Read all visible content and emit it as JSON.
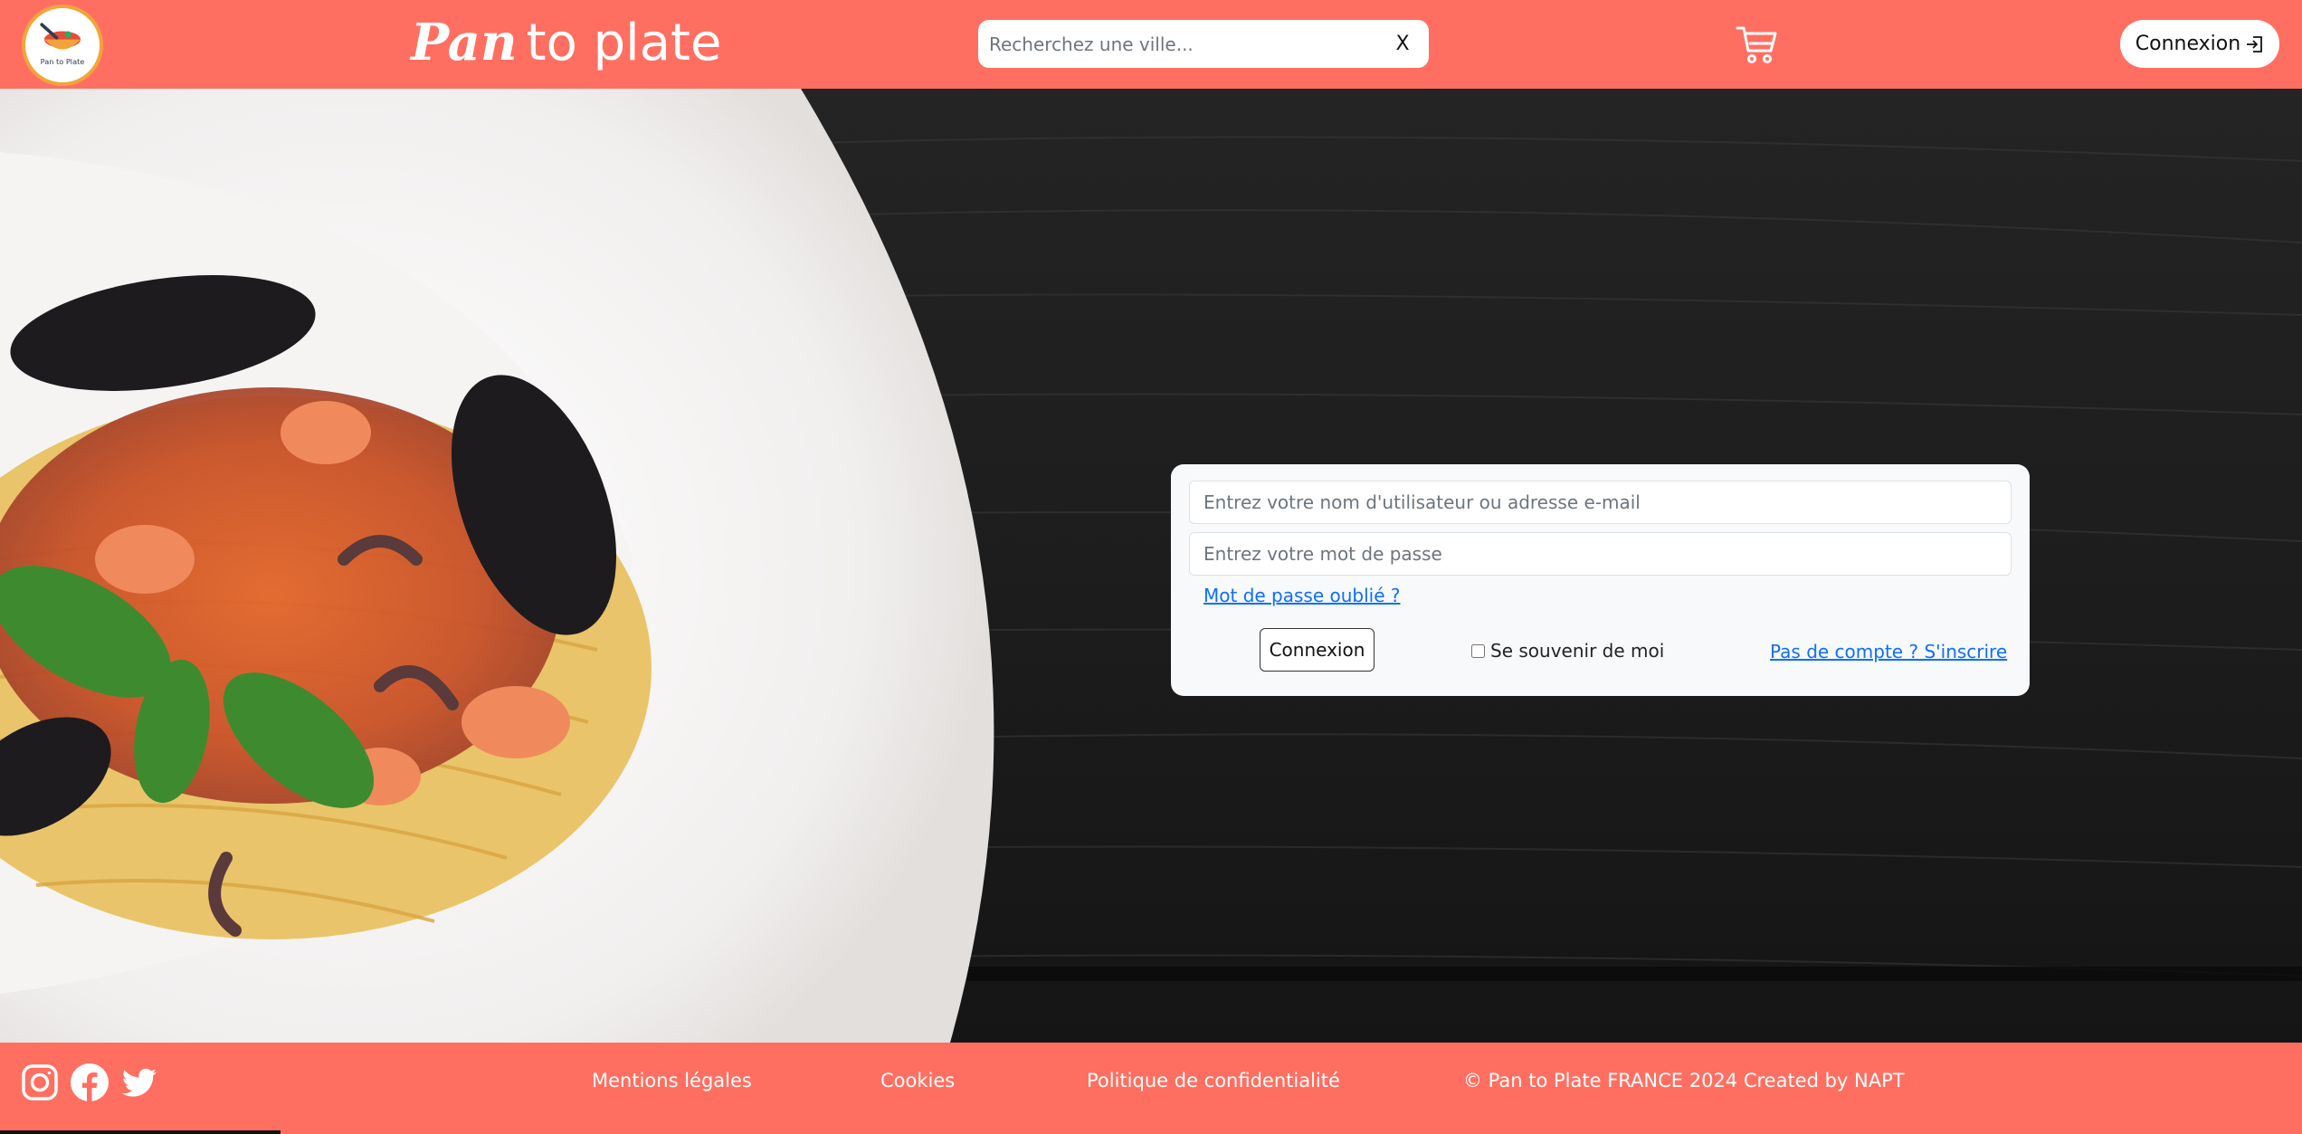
{
  "header": {
    "logo_text": "Pan to Plate",
    "brand_part1": "Pan",
    "brand_part2": "to plate",
    "search_placeholder": "Recherchez une ville...",
    "search_value": "",
    "search_clear": "X",
    "cart_icon": "cart-icon",
    "login_label": "Connexion",
    "login_icon": "login-arrow-icon"
  },
  "login_form": {
    "username_placeholder": "Entrez votre nom d'utilisateur ou adresse e-mail",
    "password_placeholder": "Entrez votre mot de passe",
    "forgot_password": "Mot de passe oublié ?",
    "submit_label": "Connexion",
    "remember_label": "Se souvenir de moi",
    "remember_checked": false,
    "signup_link": "Pas de compte ? S'inscrire"
  },
  "footer": {
    "social": [
      "instagram-icon",
      "facebook-icon",
      "twitter-icon"
    ],
    "links": [
      "Mentions légales",
      "Cookies",
      "Politique de confidentialité"
    ],
    "copyright": "© Pan to Plate FRANCE 2024 Created by NAPT"
  },
  "colors": {
    "brand": "#ff6f61",
    "link": "#0d6efd",
    "card_bg": "#f8f9fa",
    "table_dark": "#1c1c1c"
  }
}
